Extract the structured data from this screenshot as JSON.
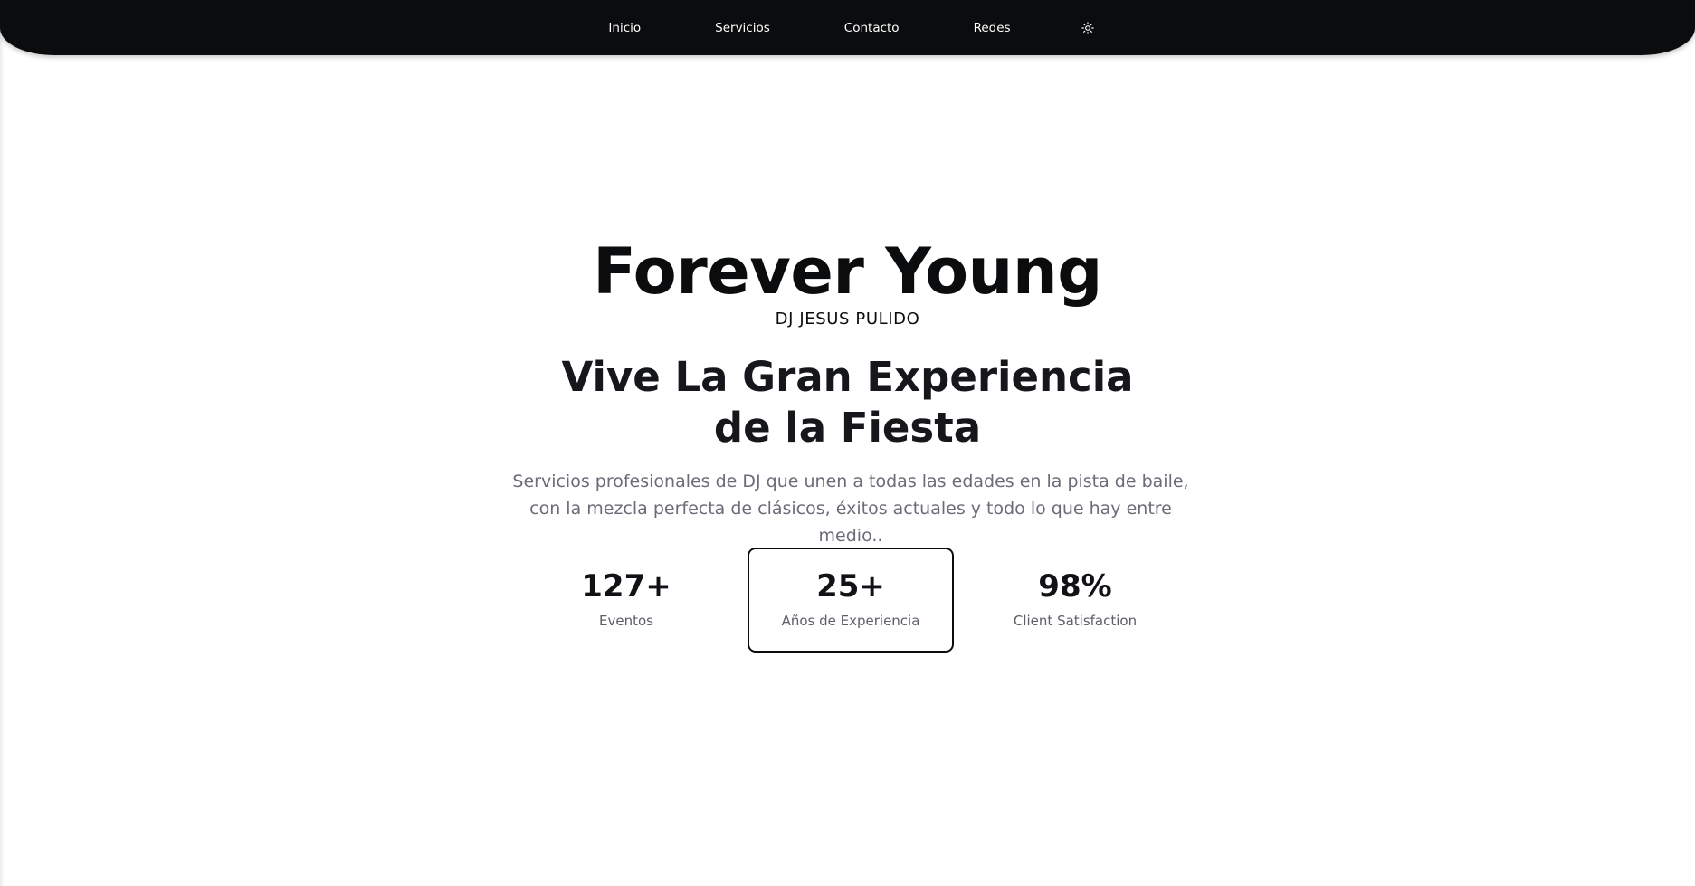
{
  "nav": {
    "items": [
      {
        "label": "Inicio"
      },
      {
        "label": "Servicios"
      },
      {
        "label": "Contacto"
      },
      {
        "label": "Redes"
      }
    ],
    "theme_toggle_icon": "sun-icon"
  },
  "hero": {
    "title": "Forever Young",
    "subtitle": "DJ JESUS PULIDO",
    "heading_line1": "Vive La Gran Experiencia",
    "heading_line2": "de la Fiesta",
    "description": "Servicios profesionales de DJ que unen a todas las edades en la pista de baile, con la mezcla perfecta de clásicos, éxitos actuales y todo lo que hay entre medio.."
  },
  "stats": [
    {
      "value": "127+",
      "label": "Eventos"
    },
    {
      "value": "25+",
      "label": "Años de Experiencia"
    },
    {
      "value": "98%",
      "label": "Client Satisfaction"
    }
  ],
  "colors": {
    "navbar_bg": "#0b0c0e",
    "page_bg": "#ffffff",
    "text_dark": "#0b0c0e",
    "text_muted": "#6b6c78"
  }
}
